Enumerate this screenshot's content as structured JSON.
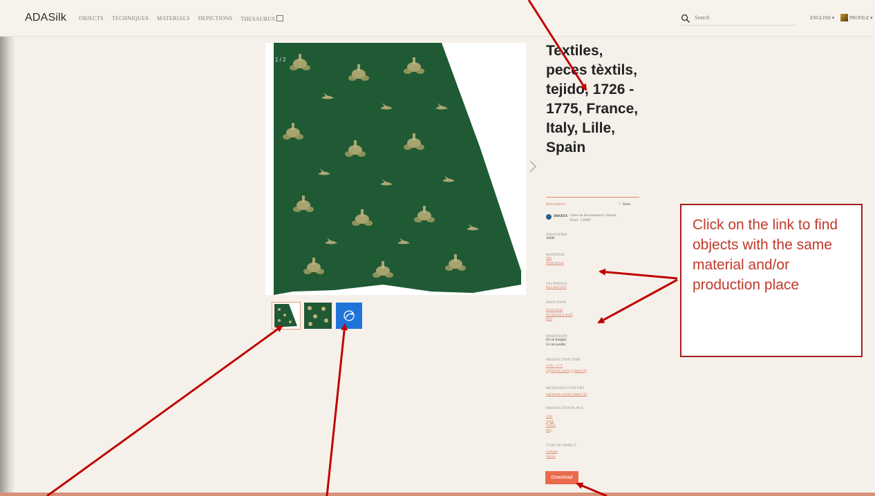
{
  "header": {
    "brand": "ADASilk",
    "nav": [
      "OBJECTS",
      "TECHNIQUES",
      "MATERIALS",
      "DEPICTIONS",
      "THESAURUS"
    ],
    "search_placeholder": "Search",
    "language": "ENGLISH ▾",
    "profile": "PROFILE ▾"
  },
  "gallery": {
    "counter": "1 / 2"
  },
  "record": {
    "title": "Textiles, peces tèxtils, tejido, 1726 - 1775, France, Italy, Lille, Spain",
    "badge": "Reconstruct",
    "save_label": "Save",
    "provider": {
      "name": "IMATEX",
      "institution": "Centre de Documentació i Museu Tèxtil - CDMT"
    },
    "identifier": {
      "label": "IDENTIFIER",
      "value": "18289"
    },
    "material": {
      "label": "MATERIAL",
      "links": [
        "Silk",
        "Metal thread"
      ]
    },
    "technique": {
      "label": "TECHNIQUE",
      "links": [
        "Brocaded weft"
      ]
    },
    "depiction": {
      "label": "DEPICTION",
      "links": [
        "Floral motif",
        "Architectural motif",
        "Bird"
      ]
    },
    "dimension": {
      "label": "DIMENSION",
      "values": [
        "49 cm (height)",
        "52 cm (width)"
      ]
    },
    "production_time": {
      "label": "PRODUCTION TIME",
      "links": [
        "1726 - 1775",
        "eighteenth century (dates CE)"
      ]
    },
    "metadata_century": {
      "label": "METADATA CENTURY",
      "links": [
        "eighteenth century (dates CE)"
      ]
    },
    "production_place": {
      "label": "PRODUCTION PLACE",
      "links": [
        "Lille",
        "Spain",
        "France",
        "Italy"
      ]
    },
    "type_of_object": {
      "label": "TYPE OF OBJECT",
      "links": [
        "costume",
        "fabrics"
      ]
    },
    "download_label": "Download"
  },
  "annotation": {
    "callout_text": "Click on the link to find objects with the same material and/or production place"
  },
  "colors": {
    "accent": "#ea6a4e",
    "link": "#d9806a",
    "annotation_red": "#c0392b",
    "textile_green": "#1f5a35",
    "motif_gold": "#bfb27a"
  }
}
